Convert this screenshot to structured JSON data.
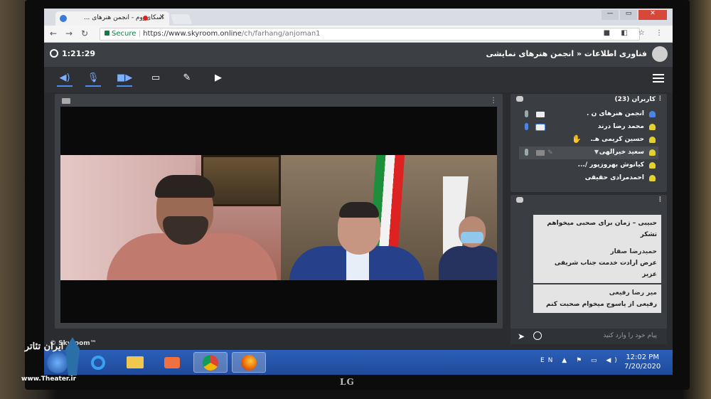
{
  "browser": {
    "tab_title": "اسکای‌روم - انجمن هنرهای ...",
    "secure_label": "Secure",
    "url_domain": "https://www.skyroom.online",
    "url_path": "/ch/farhang/anjoman1",
    "window_controls": [
      "minimize-icon",
      "maximize-icon",
      "close-icon"
    ]
  },
  "app": {
    "timer": "1:21:29",
    "breadcrumb": "فناوری اطلاعات « انجمن هنرهای نمایشی",
    "brand": "© Skyroom™",
    "toolbar": [
      "speaker-icon",
      "mic-icon",
      "camera-icon",
      "screen-share-icon",
      "whiteboard-icon",
      "video-file-icon"
    ]
  },
  "users": {
    "title": "کاربران (23)",
    "items": [
      {
        "name": "انجمن هنرهای ن .",
        "role": "admin",
        "mic": "on",
        "cam": "on"
      },
      {
        "name": "محمد رضا درند",
        "role": "user",
        "mic": "on",
        "cam": "on"
      },
      {
        "name": "حسین کریمی هـ.",
        "role": "user",
        "hand": true
      },
      {
        "name": "سعید خیرالهی",
        "role": "user",
        "selected": true
      },
      {
        "name": "کیانوش بهروزپور /...",
        "role": "user"
      },
      {
        "name": "احمدمرادی حقیقی",
        "role": "user"
      }
    ]
  },
  "chat": {
    "messages": [
      {
        "text": "حبیبی – زمان برای صحبی میخواهم تشکر"
      },
      {
        "author": "حمیدرضا صفار",
        "text": "عرض ارادت خدمت جناب شریفی عزیز"
      },
      {
        "author": "میر رضا رفیعی",
        "text": "رفیعی از یاسوج میخوام صحبت کنم"
      }
    ],
    "input_placeholder": "پیام خود را وارد کنید"
  },
  "taskbar": {
    "language": "EN",
    "time": "12:02 PM",
    "date": "7/20/2020"
  },
  "monitor_brand": "LG",
  "watermark": {
    "name": "ایران تئاتر",
    "url": "www.Theater.ir"
  }
}
